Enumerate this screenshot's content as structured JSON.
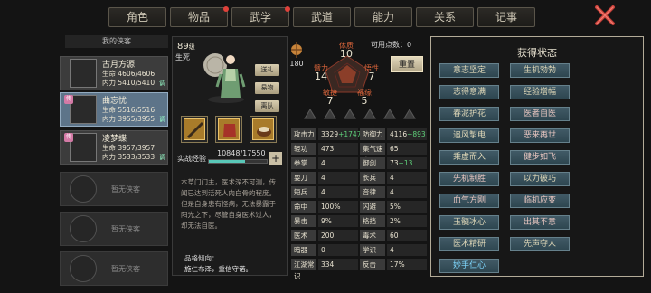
{
  "tabs": [
    {
      "label": "角色",
      "active": true,
      "dot": false
    },
    {
      "label": "物品",
      "active": false,
      "dot": true
    },
    {
      "label": "武学",
      "active": false,
      "dot": true
    },
    {
      "label": "武道",
      "active": false,
      "dot": false
    },
    {
      "label": "能力",
      "active": false,
      "dot": false
    },
    {
      "label": "关系",
      "active": false,
      "dot": false
    },
    {
      "label": "记事",
      "active": false,
      "dot": false
    }
  ],
  "party": {
    "header": "我的侠客",
    "members": [
      {
        "name": "古月方源",
        "hp": "生命 4606/4606",
        "mp": "内力 5410/5410",
        "tag": "调",
        "badge": "",
        "selected": false
      },
      {
        "name": "曲忘忧",
        "hp": "生命 5516/5516",
        "mp": "内力 3955/3955",
        "tag": "调",
        "badge": "传",
        "selected": true
      },
      {
        "name": "凌梦蝶",
        "hp": "生命 3957/3957",
        "mp": "内力 3533/3533",
        "tag": "调",
        "badge": "传",
        "selected": false
      }
    ],
    "empty_label": "暂无侠客"
  },
  "character": {
    "level": "89",
    "level_unit": "级",
    "sect": "生死",
    "buttons": [
      "送礼",
      "易物",
      "离队"
    ],
    "exp_label": "实战经验",
    "exp_value": "10848/17550",
    "exp_fraction": 0.618,
    "description": "本草门门主，医术深不可测，传闻已达到活死人肉白骨的程度。但是自身患有怪病，无法暴露于阳光之下，尽管自身医术过人，却无法自医。",
    "personality_head": "品格倾向：",
    "personality": "施仁布泽，重信守诺。"
  },
  "attributes": {
    "points_label": "可用点数：0",
    "reset_label": "重置",
    "potential": "180",
    "tizhi": {
      "label": "体质",
      "value": "10"
    },
    "biili": {
      "label": "臂力",
      "value": "14"
    },
    "wuxing": {
      "label": "悟性",
      "value": "7"
    },
    "minjie": {
      "label": "敏捷",
      "value": "7"
    },
    "fuyuan": {
      "label": "福缘",
      "value": "5"
    }
  },
  "stats": [
    [
      "攻击力",
      "3329",
      "+1747",
      "防御力",
      "4116",
      "+893"
    ],
    [
      "轻功",
      "473",
      "",
      "集气速度",
      "65",
      ""
    ],
    [
      "拳掌",
      "4",
      "",
      "御剑",
      "73",
      "+13"
    ],
    [
      "耍刀",
      "4",
      "",
      "长兵",
      "4",
      ""
    ],
    [
      "短兵",
      "4",
      "",
      "音律",
      "4",
      ""
    ],
    [
      "命中",
      "100%",
      "",
      "闪避",
      "5%",
      ""
    ],
    [
      "暴击",
      "9%",
      "",
      "格挡",
      "2%",
      ""
    ],
    [
      "医术",
      "200",
      "",
      "毒术",
      "60",
      ""
    ],
    [
      "暗器",
      "0",
      "",
      "学识",
      "4",
      ""
    ],
    [
      "江湖常识",
      "334",
      "",
      "反击",
      "17%",
      ""
    ]
  ],
  "status_panel": {
    "title": "获得状态",
    "items": [
      {
        "label": "意志坚定",
        "kind": "pos"
      },
      {
        "label": "生机勃勃",
        "kind": "pos"
      },
      {
        "label": "志得意满",
        "kind": "pos"
      },
      {
        "label": "经验增幅",
        "kind": "pos"
      },
      {
        "label": "春泥护花",
        "kind": "pos"
      },
      {
        "label": "医者自医",
        "kind": "neg"
      },
      {
        "label": "追风掣电",
        "kind": "pos"
      },
      {
        "label": "恶来再世",
        "kind": "neg"
      },
      {
        "label": "乘虚而入",
        "kind": "pos"
      },
      {
        "label": "健步如飞",
        "kind": "neg"
      },
      {
        "label": "先机制胜",
        "kind": "neg"
      },
      {
        "label": "以力破巧",
        "kind": "pos"
      },
      {
        "label": "血气方刚",
        "kind": "neg"
      },
      {
        "label": "临机应变",
        "kind": "neg"
      },
      {
        "label": "玉髓冰心",
        "kind": "pos"
      },
      {
        "label": "出其不意",
        "kind": "neg"
      },
      {
        "label": "医术精研",
        "kind": "pos"
      },
      {
        "label": "先声夺人",
        "kind": "pos"
      },
      {
        "label": "妙手仁心",
        "kind": "hl"
      }
    ]
  },
  "colors": {
    "accent_red": "#d9643a",
    "bonus_green": "#5fd07a",
    "exp_bar": "#59c8b8"
  }
}
